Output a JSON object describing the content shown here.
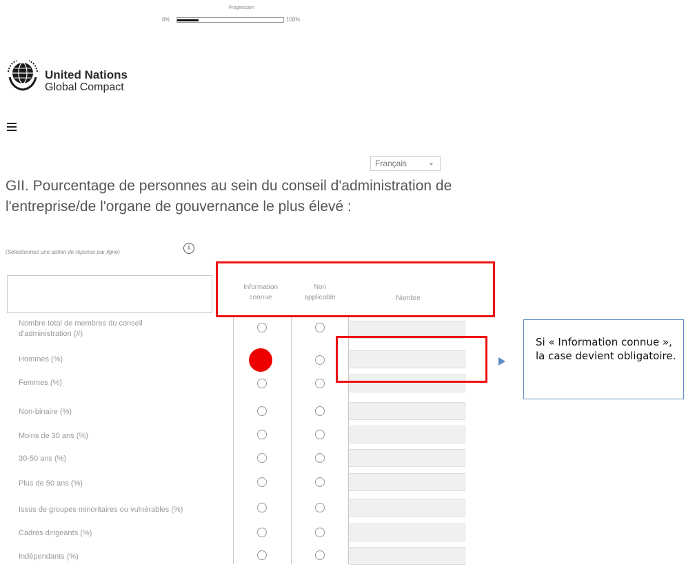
{
  "progress": {
    "label": "Progression",
    "min_label": "0%",
    "max_label": "100%",
    "value": 0.2
  },
  "brand": {
    "line1": "United Nations",
    "line2": "Global Compact",
    "logo_icon": "un-global-compact-emblem"
  },
  "menu": {
    "icon": "hamburger-menu-icon"
  },
  "language": {
    "selected": "Français",
    "icon": "chevron-down-icon"
  },
  "question": {
    "title": "GII. Pourcentage de personnes au sein du conseil d'administration de l'entreprise/de l'organe de gouvernance le plus élevé :",
    "instruction": "(Sélectionnez une option de réponse par ligne)",
    "info_label": "i"
  },
  "table": {
    "headers": {
      "col1_line1": "Information",
      "col1_line2": "connue",
      "col2_line1": "Non",
      "col2_line2": "applicable",
      "col3": "Nombre"
    },
    "rows": [
      {
        "label_line1": "Nombre total de membres du conseil",
        "label_line2": "d'administration (#)"
      },
      {
        "label_line1": "Hommes (%)"
      },
      {
        "label_line1": "Femmes (%)"
      },
      {
        "label_line1": "Non-binaire (%)"
      },
      {
        "label_line1": "Moins de 30 ans (%)"
      },
      {
        "label_line1": "30-50 ans (%)"
      },
      {
        "label_line1": "Plus de 50 ans (%)"
      },
      {
        "label_line1": "Issus de groupes minoritaires ou vulnérables (%)"
      },
      {
        "label_line1": "Cadres dirigeants (%)"
      },
      {
        "label_line1": "Indépendants (%)"
      }
    ]
  },
  "annotation": {
    "text": "Si « Information connue », la case devient obligatoire.",
    "highlight_color": "#ee1111",
    "callout_border_color": "#5b8ac4"
  }
}
